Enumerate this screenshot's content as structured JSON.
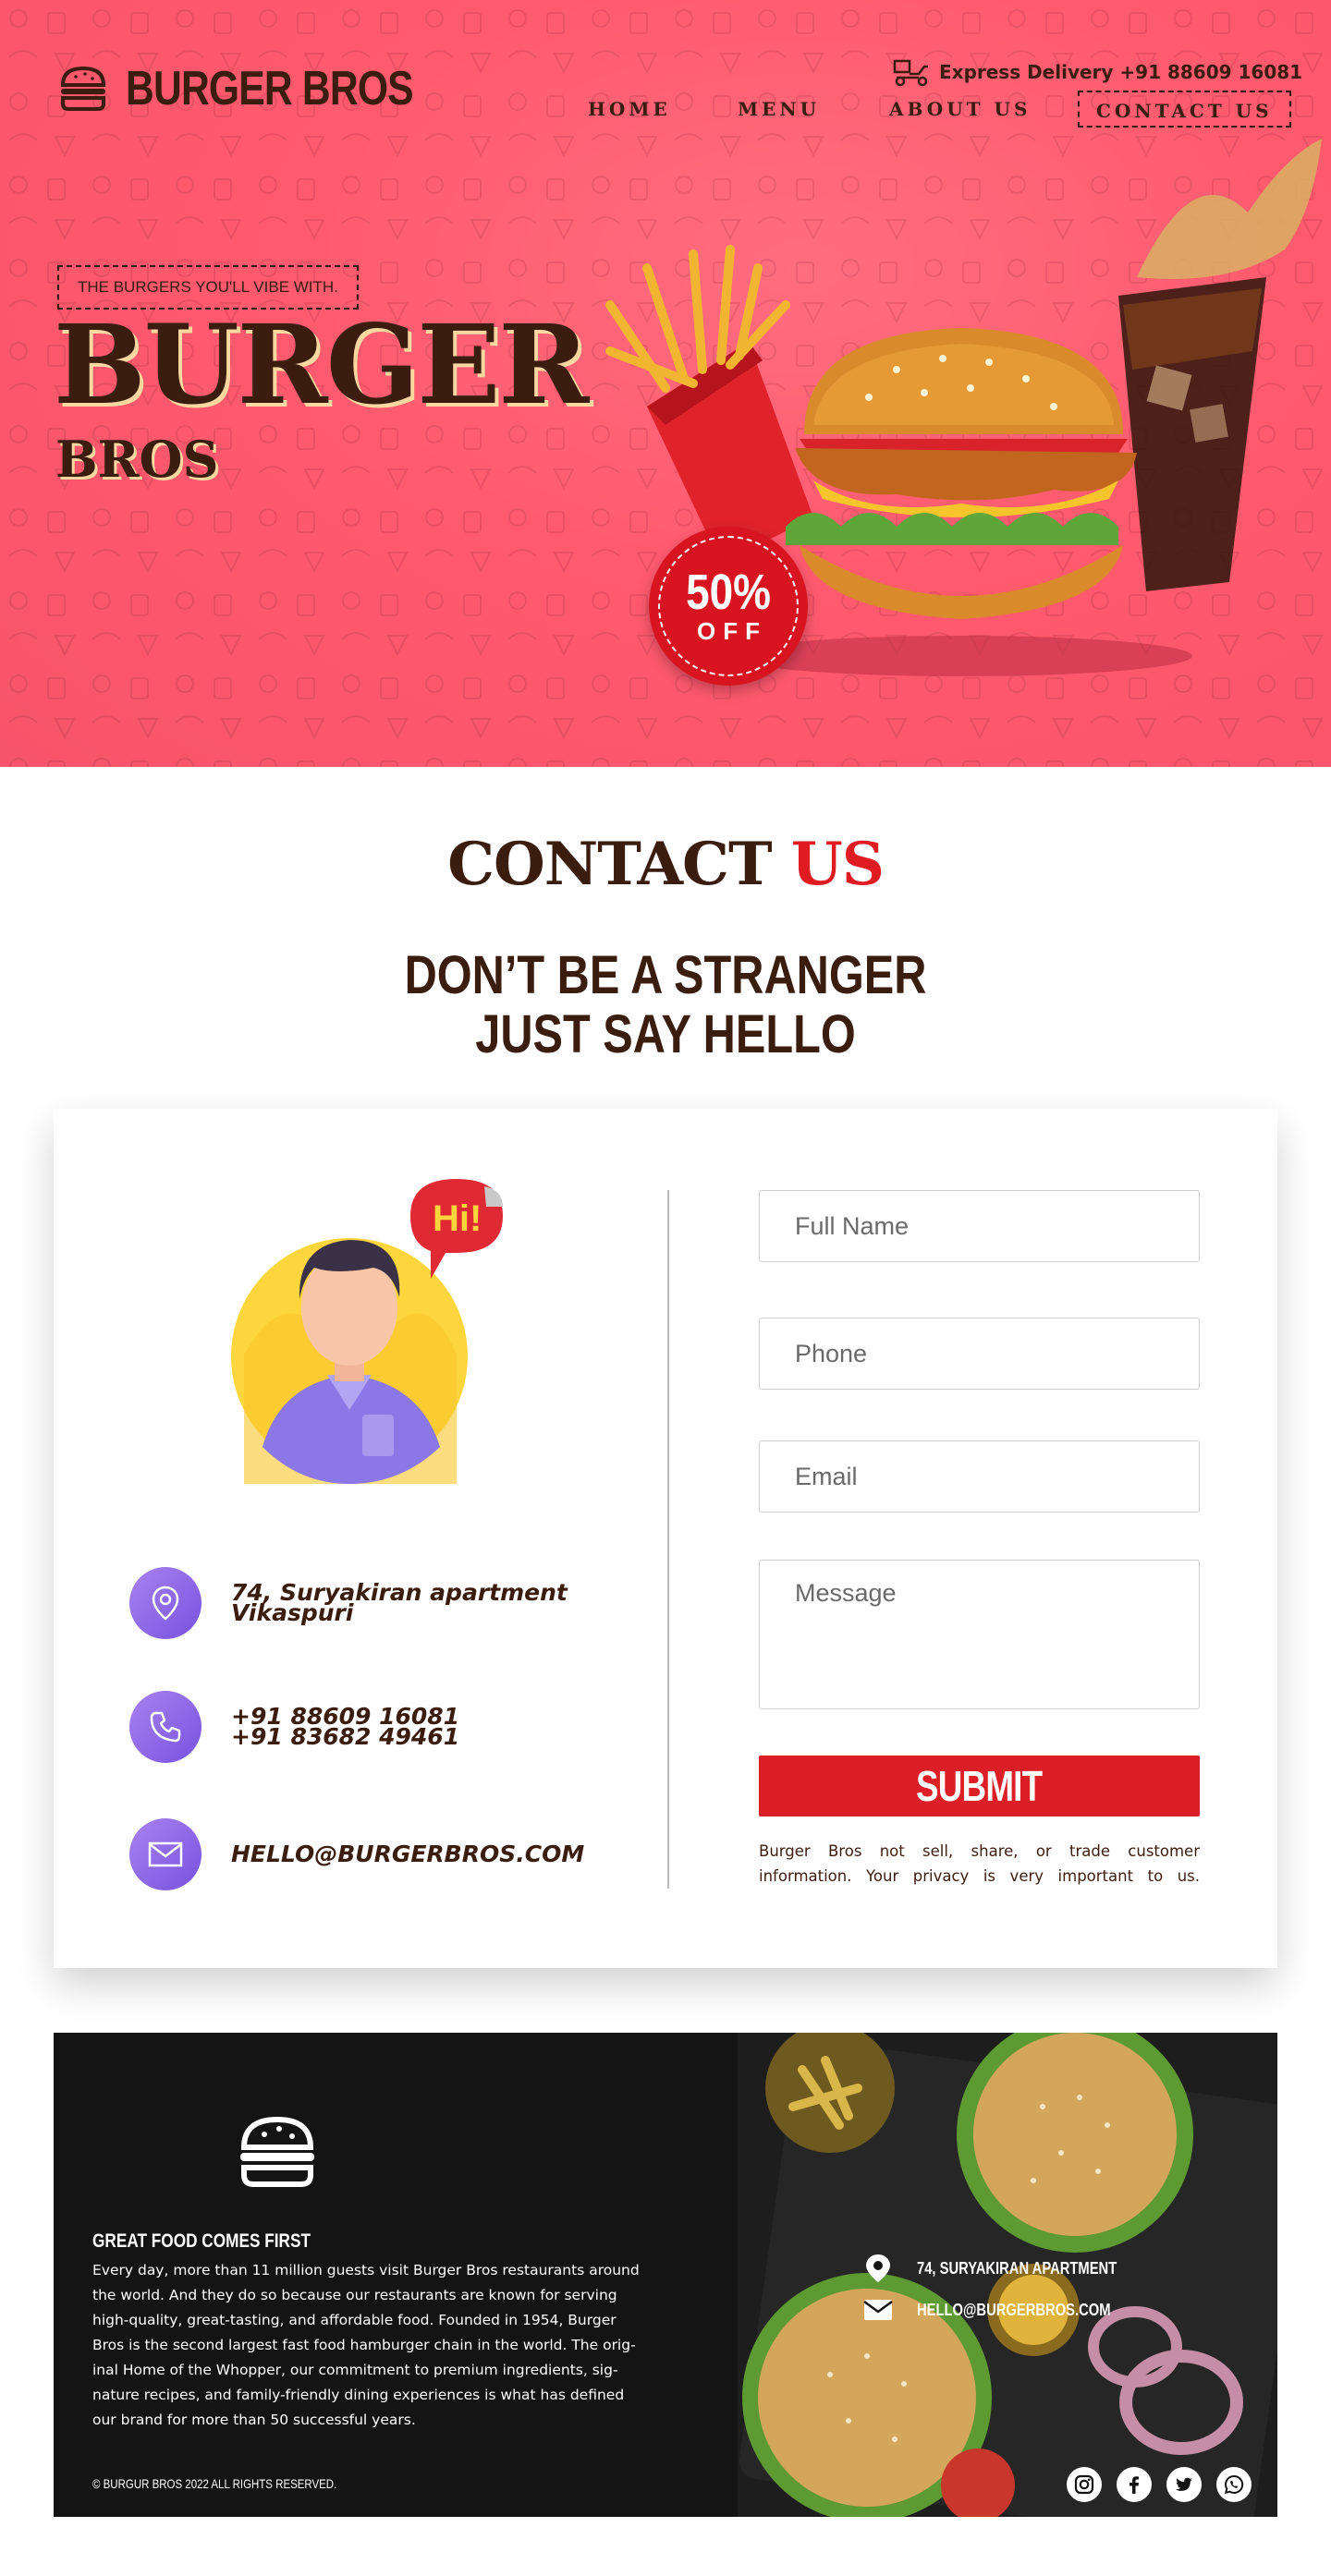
{
  "brand": {
    "name": "BURGER BROS",
    "logo_icon": "burger-icon"
  },
  "header": {
    "delivery_text": "Express Delivery +91 88609 16081",
    "delivery_icon": "delivery-scooter-icon",
    "nav": [
      {
        "label": "HOME"
      },
      {
        "label": "MENU"
      },
      {
        "label": "ABOUT US"
      },
      {
        "label": "CONTACT US",
        "active": true
      }
    ]
  },
  "hero": {
    "tagline": "THE BURGERS YOU'LL VIBE WITH.",
    "title": "BURGER",
    "subtitle": "BROS",
    "discount_value": "50%",
    "discount_label": "OFF"
  },
  "contact": {
    "title_main": "CONTACT",
    "title_accent": "US",
    "tagline_line1": "DON’T BE A STRANGER",
    "tagline_line2": "JUST SAY HELLO",
    "avatar_bubble": "Hi!",
    "address_line1": "74, Suryakiran apartment",
    "address_line2": "Vikaspuri",
    "phone_line1": "+91 88609 16081",
    "phone_line2": "+91 83682 49461",
    "email": "HELLO@BURGERBROS.COM",
    "form": {
      "full_name_placeholder": "Full Name",
      "phone_placeholder": "Phone",
      "email_placeholder": "Email",
      "message_placeholder": "Message",
      "submit_label": "SUBMIT",
      "privacy_line1": "Burger Bros not sell, share, or trade customer",
      "privacy_line2": "information. Your privacy is very important to us."
    }
  },
  "footer": {
    "heading": "GREAT FOOD COMES FIRST",
    "body_lines": [
      "Every day, more than 11 million guests visit Burger Bros restaurants around",
      "the world. And they do so because our  restaurants are known for serving",
      "high-quality, great-tasting, and affordable food. Founded in 1954, Burger",
      "Bros is the second largest fast food hamburger chain in the world. The orig-",
      "inal Home of the Whopper, our commitment to premium ingredients, sig-",
      "nature recipes, and family-friendly dining experiences is what has defined",
      "our brand for more than 50 successful years."
    ],
    "address": "74, SURYAKIRAN APARTMENT",
    "email": "HELLO@BURGERBROS.COM",
    "copyright": "© BURGUR BROS 2022 ALL RIGHTS RESERVED.",
    "socials": [
      "instagram-icon",
      "facebook-icon",
      "twitter-icon",
      "whatsapp-icon"
    ]
  },
  "colors": {
    "hero_bg": "#ff5a6e",
    "brown": "#3b1d10",
    "accent_red": "#e01b22",
    "icon_purple": "#8a66e8",
    "footer_bg": "#141414"
  }
}
